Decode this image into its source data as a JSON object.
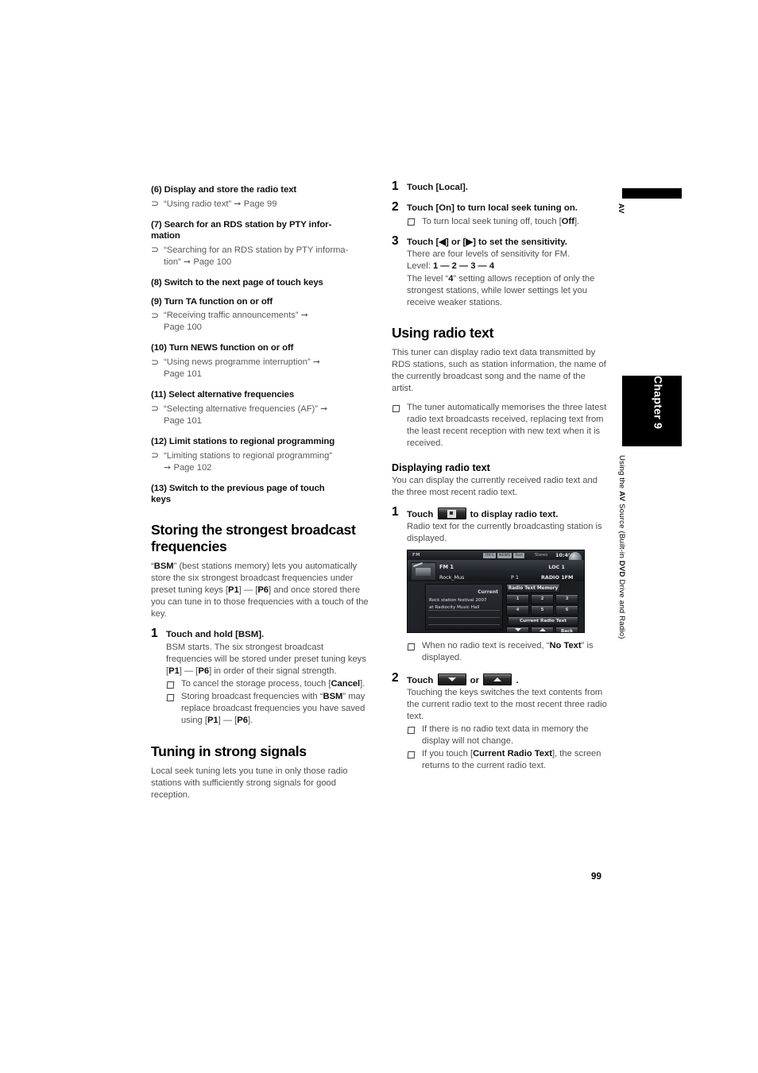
{
  "page": {
    "number": "99",
    "ref_glyph": "⊃",
    "arrow_glyph": "➞"
  },
  "margin": {
    "av_label": "AV",
    "chapter_label": "Chapter 9",
    "running_title_pre": "Using the ",
    "running_title_b1": "AV",
    "running_title_mid": " Source (Built-in ",
    "running_title_b2": "DVD",
    "running_title_post": " Drive and Radio)"
  },
  "left_column": {
    "features": [
      {
        "label": "(6) Display and store the radio text",
        "ref": "“Using radio text” ➞ Page 99"
      },
      {
        "label": "(7) Search for an RDS station by PTY infor-mation",
        "label_line1": "(7) Search for an ",
        "label_b": "RDS",
        "label_line2": " station by ",
        "label_b2": "PTY",
        "label_line3": " infor-mation",
        "ref": "“Searching for an RDS station by PTY informa-tion” ➞ Page 100"
      },
      {
        "label": "(8) Switch to the next page of touch keys",
        "ref": ""
      },
      {
        "label": "(9) Turn TA function on or off",
        "ref": "“Receiving traffic announcements” ➞ Page 100"
      },
      {
        "label": "(10) Turn NEWS function on or off",
        "ref": "“Using news programme interruption” ➞ Page 101"
      },
      {
        "label": "(11) Select alternative frequencies",
        "ref": "“Selecting alternative frequencies (AF)” ➞ Page 101"
      },
      {
        "label": "(12) Limit stations to regional programming",
        "ref": "“Limiting stations to regional programming” ➞ Page 102"
      },
      {
        "label": "(13) Switch to the previous page of touch keys",
        "ref": ""
      }
    ],
    "section_bsm": {
      "heading": "Storing the strongest broadcast frequencies",
      "intro": "“BSM” (best stations memory) lets you automatically store the six strongest broadcast frequencies under preset tuning keys [P1] — [P6] and once stored there you can tune in to those frequencies with a touch of the key.",
      "step1_num": "1",
      "step1_title": "Touch and hold [BSM].",
      "step1_body": "BSM starts. The six strongest broadcast frequencies will be stored under preset tuning keys [P1] — [P6] in order of their signal strength.",
      "note1": "To cancel the storage process, touch [Cancel].",
      "note2": "Storing broadcast frequencies with “BSM” may replace broadcast frequencies you have saved using [P1] — [P6]."
    },
    "section_local": {
      "heading": "Tuning in strong signals",
      "intro": "Local seek tuning lets you tune in only those radio stations with sufficiently strong signals for good reception."
    }
  },
  "right_column": {
    "steps_local": [
      {
        "num": "1",
        "title": "Touch [Local].",
        "body": "",
        "notes": []
      },
      {
        "num": "2",
        "title": "Touch [On] to turn local seek tuning on.",
        "body": "",
        "notes": [
          "To turn local seek tuning off, touch [Off]."
        ]
      },
      {
        "num": "3",
        "title": "Touch [◀] or [▶] to set the sensitivity.",
        "body": "There are four levels of sensitivity for FM.",
        "level_label": "Level: ",
        "level_value": "1 — 2 — 3 — 4",
        "body2": "The level “4” setting allows reception of only the strongest stations, while lower settings let you receive weaker stations.",
        "notes": []
      }
    ],
    "section_radiotext": {
      "heading": "Using radio text",
      "intro": "This tuner can display radio text data transmitted by RDS stations, such as station information, the name of the currently broadcast song and the name of the artist.",
      "note1": "The tuner automatically memorises the three latest radio text broadcasts received, replacing text from the least recent reception with new text when it is received.",
      "sub_heading": "Displaying radio text",
      "sub_intro": "You can display the currently received radio text and the three most recent radio text.",
      "step1_num": "1",
      "step1_title_pre": "Touch ",
      "step1_title_post": " to display radio text.",
      "step1_icon": "radio-text-key-icon",
      "step1_body": "Radio text for the currently broadcasting station is displayed.",
      "step1_note": "When no radio text is received, “No Text” is displayed.",
      "step2_num": "2",
      "step2_title_pre": "Touch ",
      "step2_title_mid": " or ",
      "step2_title_post": " .",
      "step2_icon_a": "down-arrow-key-icon",
      "step2_icon_b": "up-arrow-key-icon",
      "step2_body": "Touching the keys switches the text contents from the current radio text to the most recent three radio text.",
      "step2_note1": "If there is no radio text data in memory the display will not change.",
      "step2_note2": "If you touch [Current Radio Text], the screen returns to the current radio text."
    }
  },
  "device_screenshot": {
    "status": {
      "source": "FM",
      "indicators": [
        "TRFC",
        "NEWS",
        "Text"
      ],
      "stereo": "Stereo",
      "clock": "10:48"
    },
    "info": {
      "band": "FM 1",
      "local": "LOC 1",
      "pty": "Rock_Mus",
      "preset": "P 1",
      "freq_label": "RADIO 1FM"
    },
    "text_panel": {
      "current_label": "Current",
      "line1": "Rock station festival 2007",
      "line2": "at Radiocity Music Hall"
    },
    "keys": {
      "memory_header": "Radio Text Memory",
      "memory_presets": [
        "1",
        "2",
        "3",
        "4",
        "5",
        "6"
      ],
      "current_radio_text": "Current Radio Text",
      "back": "Back"
    }
  }
}
